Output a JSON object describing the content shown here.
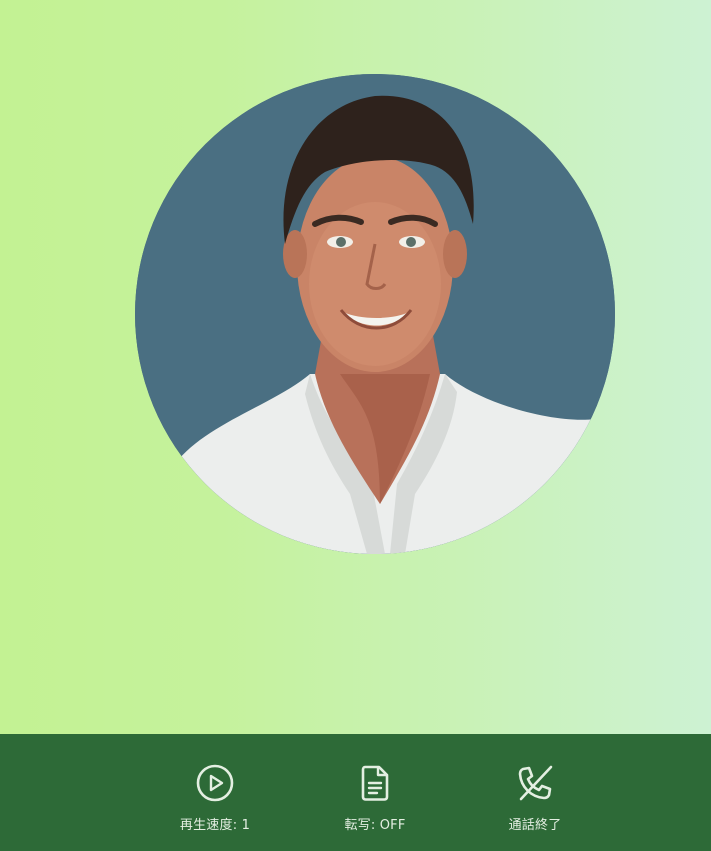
{
  "avatar": {
    "alt": "avatar"
  },
  "controls": {
    "speed_label": "再生速度: 1",
    "speed_icon": "play-circle-icon",
    "transcript_label": "転写: OFF",
    "transcript_icon": "document-icon",
    "end_call_label": "通話終了",
    "end_call_icon": "phone-off-icon"
  },
  "colors": {
    "bar_background": "#2d6a37",
    "icon_color": "#e4efe2",
    "avatar_background": "#4a6f82",
    "gradient_left": "#c3f293",
    "gradient_right": "#cdf2d3"
  }
}
